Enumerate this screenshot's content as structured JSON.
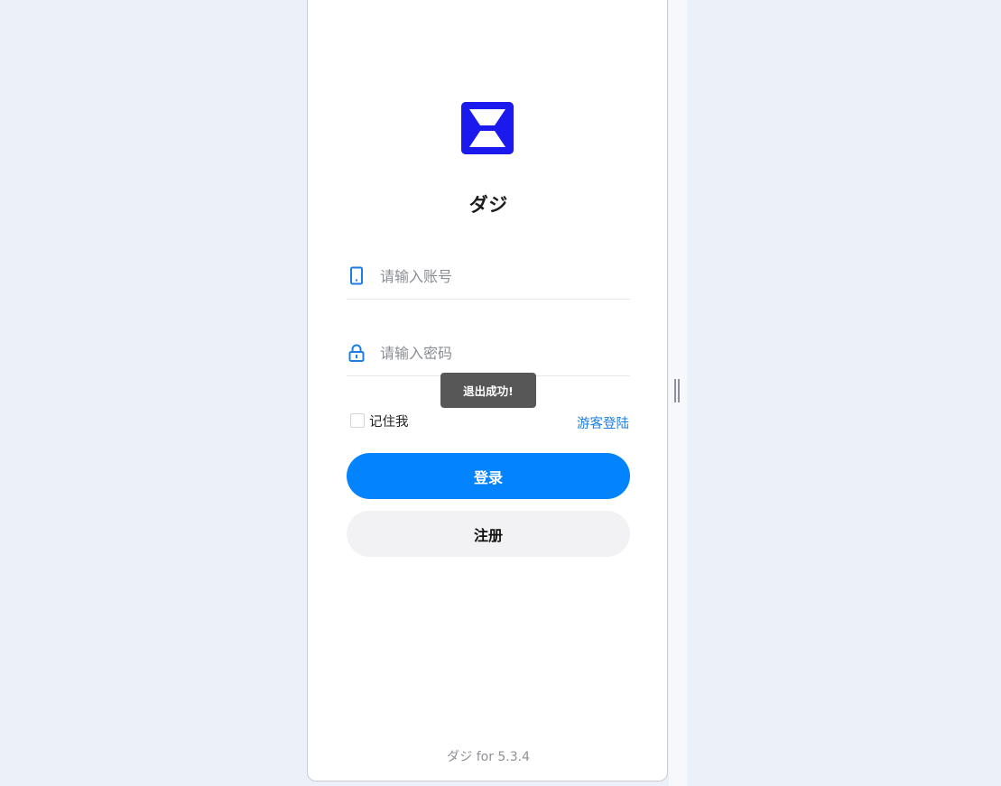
{
  "app": {
    "title": "ダジ",
    "version_footer": "ダジ for 5.3.4"
  },
  "login_form": {
    "account_placeholder": "请输入账号",
    "password_placeholder": "请输入密码",
    "remember_label": "记住我",
    "remember_checked": false,
    "guest_login_label": "游客登陆",
    "login_button": "登录",
    "register_button": "注册"
  },
  "toast": {
    "message": "退出成功!"
  },
  "icons": {
    "logo": "x-logo-icon",
    "account": "phone-icon",
    "password": "lock-icon"
  },
  "colors": {
    "accent": "#0483ff",
    "link": "#1a7ee6",
    "logo_bg": "#1a1aee",
    "page_bg": "#ecf0f8",
    "toast_bg": "#575757"
  }
}
